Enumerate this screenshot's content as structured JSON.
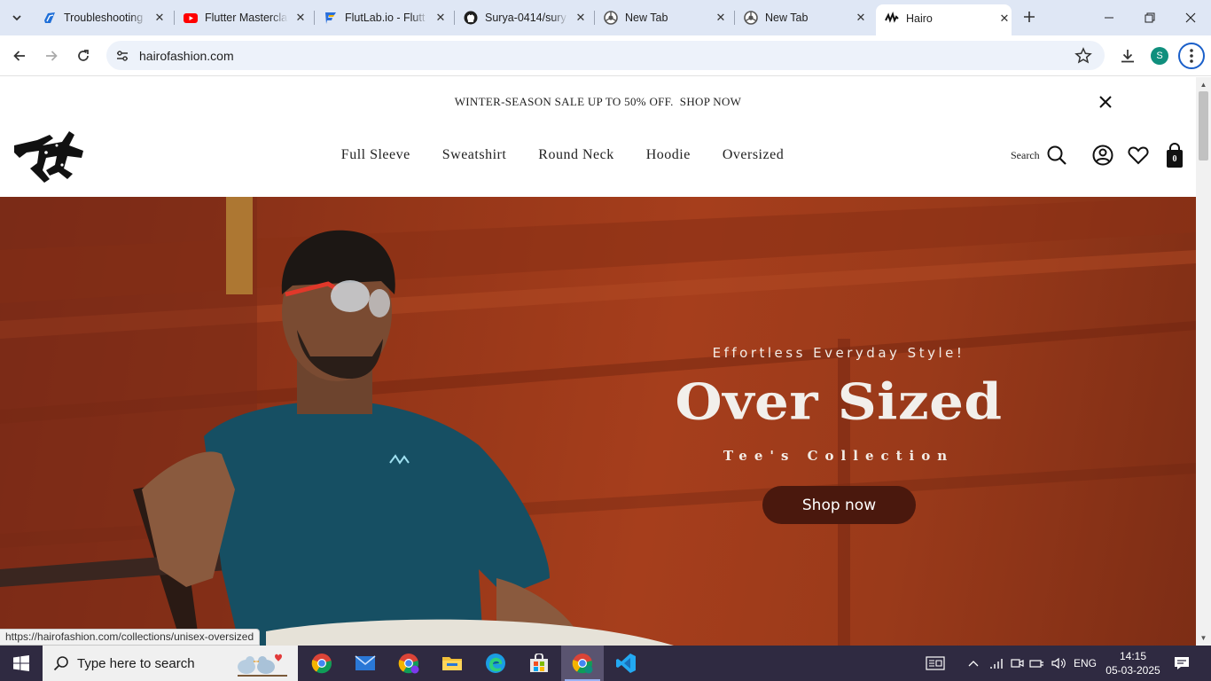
{
  "browser": {
    "tabs": [
      {
        "title": "Troubleshooting",
        "icon": "azure-devops-icon"
      },
      {
        "title": "Flutter Mastercla",
        "icon": "youtube-icon"
      },
      {
        "title": "FlutLab.io - Flutt",
        "icon": "flutlab-icon"
      },
      {
        "title": "Surya-0414/sury",
        "icon": "github-icon"
      },
      {
        "title": "New Tab",
        "icon": "chrome-icon"
      },
      {
        "title": "New Tab",
        "icon": "chrome-icon"
      },
      {
        "title": "Hairo",
        "icon": "hairo-icon",
        "active": true
      }
    ],
    "url": "hairofashion.com",
    "profile_initial": "S",
    "status_url": "https://hairofashion.com/collections/unisex-oversized"
  },
  "site": {
    "announcement": "WINTER-SEASON SALE UP TO 50% OFF.  SHOP NOW",
    "nav": [
      "Full Sleeve",
      "Sweatshirt",
      "Round Neck",
      "Hoodie",
      "Oversized"
    ],
    "search_label": "Search",
    "cart_count": "0"
  },
  "hero": {
    "eyebrow": "Effortless Everyday Style!",
    "title": "Over Sized",
    "subtitle": "Tee's Collection",
    "cta": "Shop now"
  },
  "taskbar": {
    "search_placeholder": "Type here to search",
    "language": "ENG",
    "time": "14:15",
    "date": "05-03-2025"
  },
  "colors": {
    "hero_background": "#9a3a1a",
    "cta_background": "#4a180d",
    "tabstrip": "#dfe7f5",
    "taskbar": "#2f2a41"
  }
}
